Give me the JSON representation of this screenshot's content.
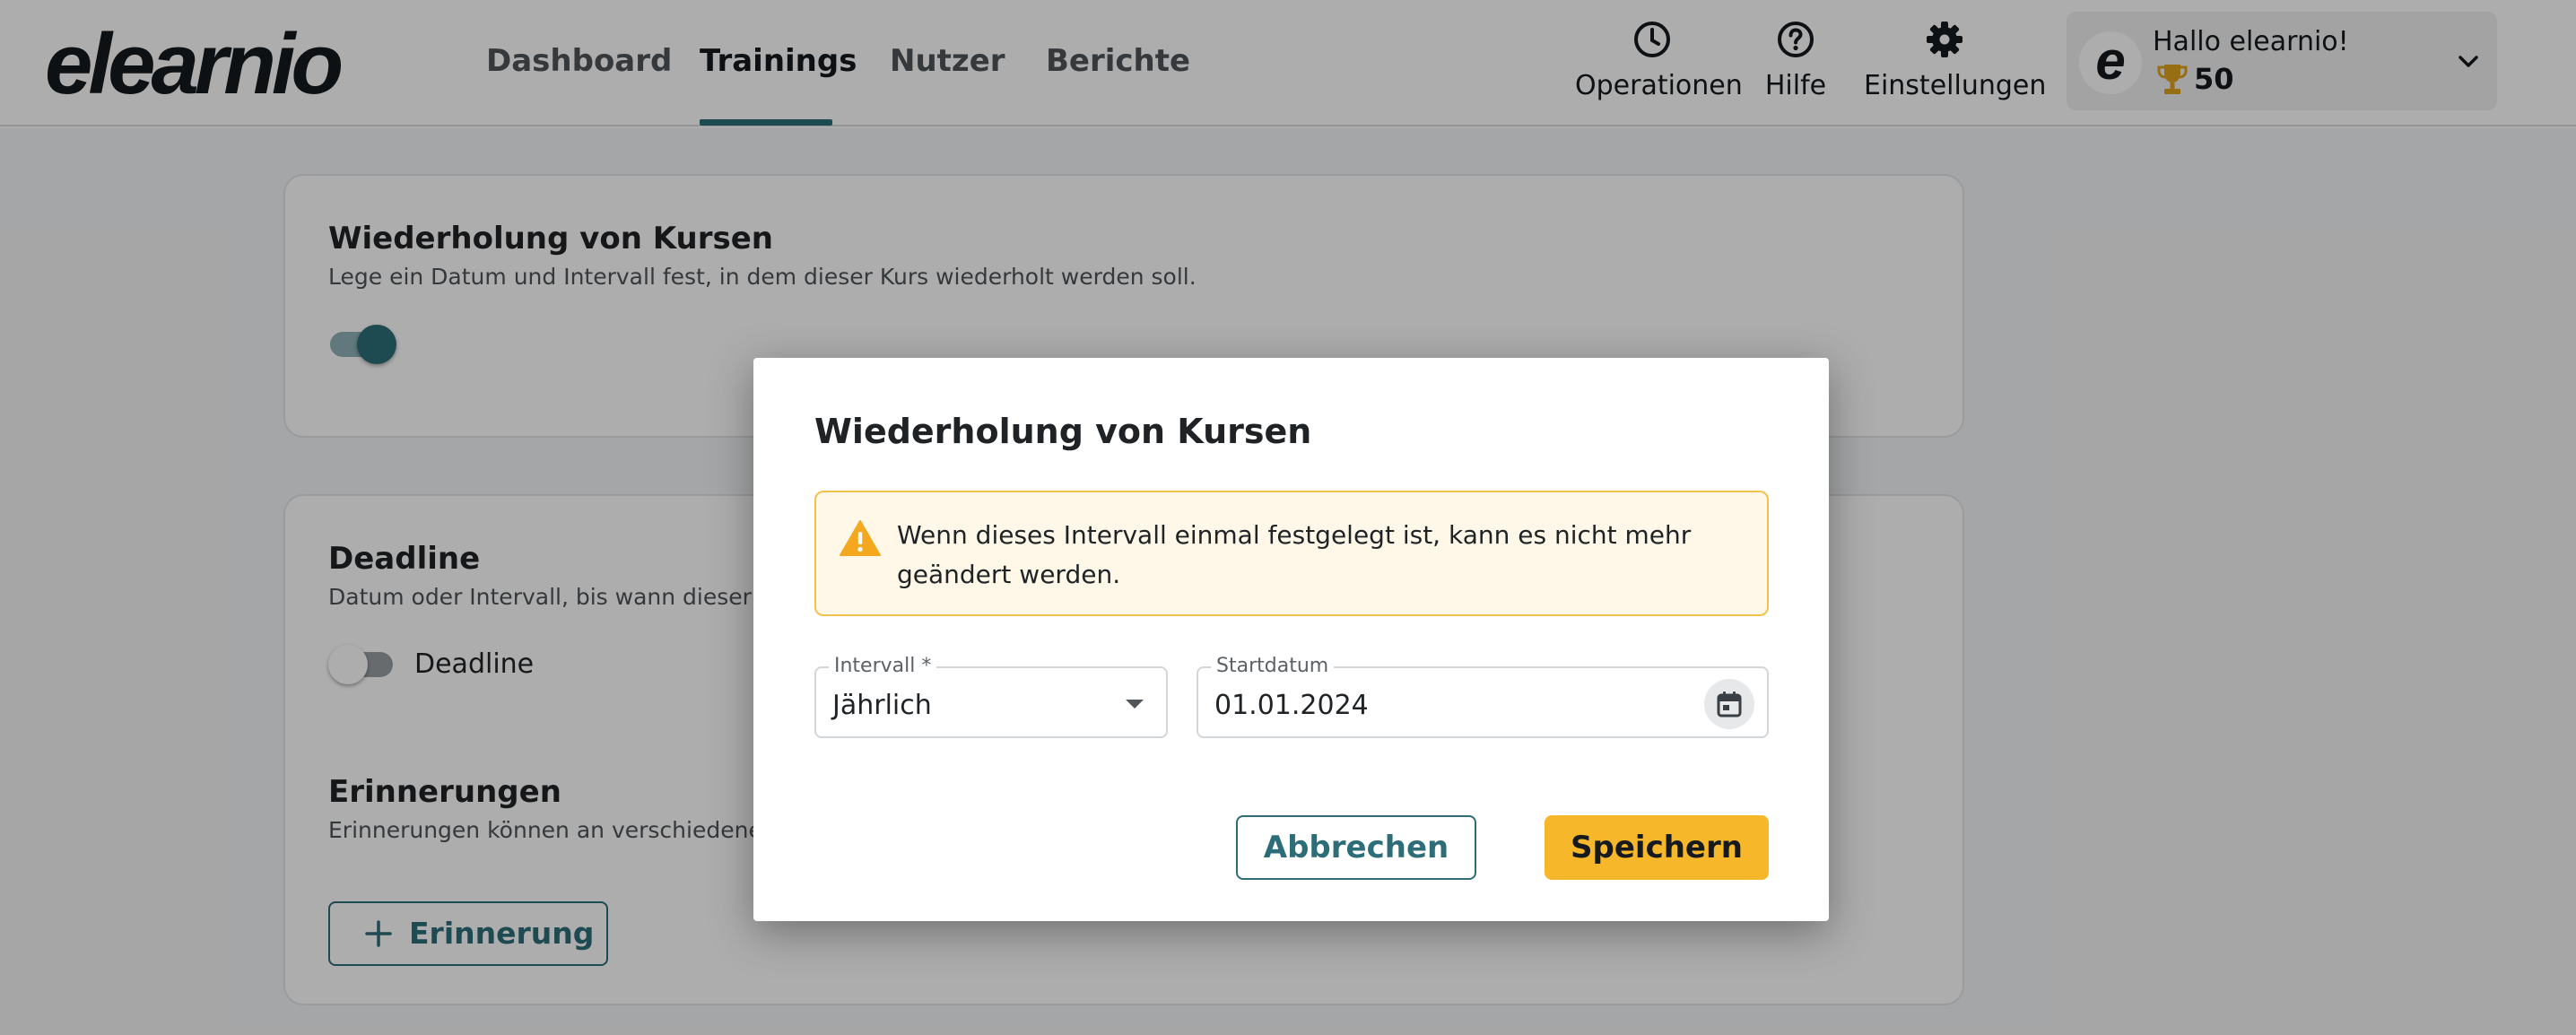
{
  "app": {
    "logo_text": "elearnio"
  },
  "nav": {
    "items": [
      {
        "label": "Dashboard"
      },
      {
        "label": "Trainings",
        "active": true
      },
      {
        "label": "Nutzer"
      },
      {
        "label": "Berichte"
      }
    ]
  },
  "toolbar": {
    "operations": {
      "label": "Operationen",
      "icon": "clock-icon"
    },
    "help": {
      "label": "Hilfe",
      "icon": "question-circle-icon"
    },
    "settings": {
      "label": "Einstellungen",
      "icon": "gear-icon"
    }
  },
  "user": {
    "avatar_letter": "e",
    "greeting": "Hallo elearnio!",
    "points": "50",
    "points_icon": "trophy-icon"
  },
  "page": {
    "recurrence_card": {
      "title": "Wiederholung von Kursen",
      "description": "Lege ein Datum und Intervall fest, in dem dieser Kurs wiederholt werden soll.",
      "toggle_on": true
    },
    "deadline_card": {
      "title": "Deadline",
      "description": "Datum oder Intervall, bis wann dieser Kurs",
      "toggle_label": "Deadline",
      "toggle_on": false,
      "reminders_title": "Erinnerungen",
      "reminders_description": "Erinnerungen können an verschiedene Em",
      "add_reminder_label": "Erinnerung"
    }
  },
  "modal": {
    "title": "Wiederholung von Kursen",
    "alert_text": "Wenn dieses Intervall einmal festgelegt ist, kann es nicht mehr geändert werden.",
    "interval": {
      "label": "Intervall *",
      "value": "Jährlich"
    },
    "start_date": {
      "label": "Startdatum",
      "value": "01.01.2024"
    },
    "cancel_label": "Abbrechen",
    "save_label": "Speichern"
  },
  "colors": {
    "accent": "#2d6d78",
    "primary_button": "#f7b72a",
    "warning_border": "#f3c24c",
    "warning_background": "#fff7e8"
  }
}
